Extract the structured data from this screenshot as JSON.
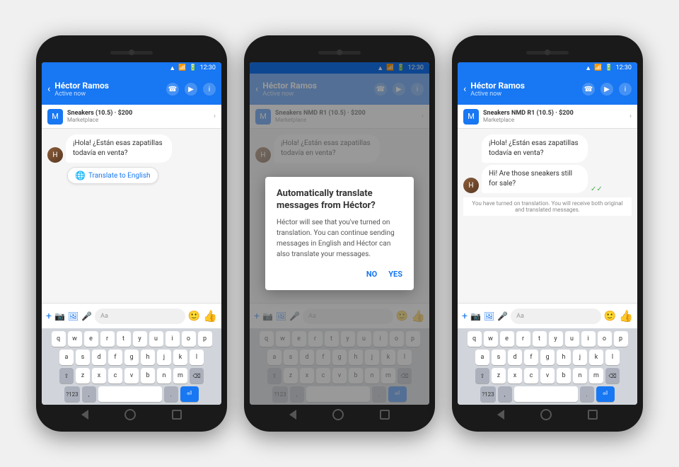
{
  "phones": [
    {
      "id": "phone1",
      "contact": {
        "name": "Héctor Ramos",
        "status": "Active now"
      },
      "marketplace": {
        "title": "Sneakers (10.5) · $200",
        "label": "Marketplace"
      },
      "messages": [
        {
          "type": "incoming",
          "text": "¡Hola! ¿Están esas zapatillas todavía en venta?"
        }
      ],
      "translate_btn": "Translate to English",
      "input_placeholder": "Aa",
      "state": "translate_button",
      "time": "12:30"
    },
    {
      "id": "phone2",
      "contact": {
        "name": "Héctor Ramos",
        "status": "Active now"
      },
      "marketplace": {
        "title": "Sneakers NMD R1 (10.5) · $200",
        "label": "Marketplace"
      },
      "messages": [
        {
          "type": "incoming",
          "text": "¡Hola! ¿Están esas zapatillas todavía en venta?"
        }
      ],
      "input_placeholder": "Aa",
      "state": "modal",
      "time": "12:30",
      "modal": {
        "title": "Automatically translate messages from Héctor?",
        "body": "Héctor will see that you've turned on translation. You can continue sending messages in English and Héctor can also translate your messages.",
        "no_label": "NO",
        "yes_label": "YES"
      }
    },
    {
      "id": "phone3",
      "contact": {
        "name": "Héctor Ramos",
        "status": "Active now"
      },
      "marketplace": {
        "title": "Sneakers NMD R1 (10.5) · $200",
        "label": "Marketplace"
      },
      "messages": [
        {
          "type": "incoming",
          "text1": "¡Hola! ¿Están esas zapatillas todavía en venta?",
          "text2": "Hi! Are those sneakers still for sale?"
        }
      ],
      "input_placeholder": "Aa",
      "state": "translated",
      "time": "12:30",
      "translation_note": "You have turned on translation. You will receive both original and translated messages."
    }
  ],
  "status": {
    "signal": "▲▲▲",
    "wifi": "WiFi",
    "battery": "▮▮▮"
  },
  "keyboard": {
    "row1": [
      "q",
      "w",
      "e",
      "r",
      "t",
      "y",
      "u",
      "i",
      "o",
      "p"
    ],
    "row2": [
      "a",
      "s",
      "d",
      "f",
      "g",
      "h",
      "j",
      "k",
      "l"
    ],
    "row3": [
      "z",
      "x",
      "c",
      "v",
      "b",
      "n",
      "m"
    ],
    "sym": "?123",
    "comma": ",",
    "period": ".",
    "space": ""
  }
}
